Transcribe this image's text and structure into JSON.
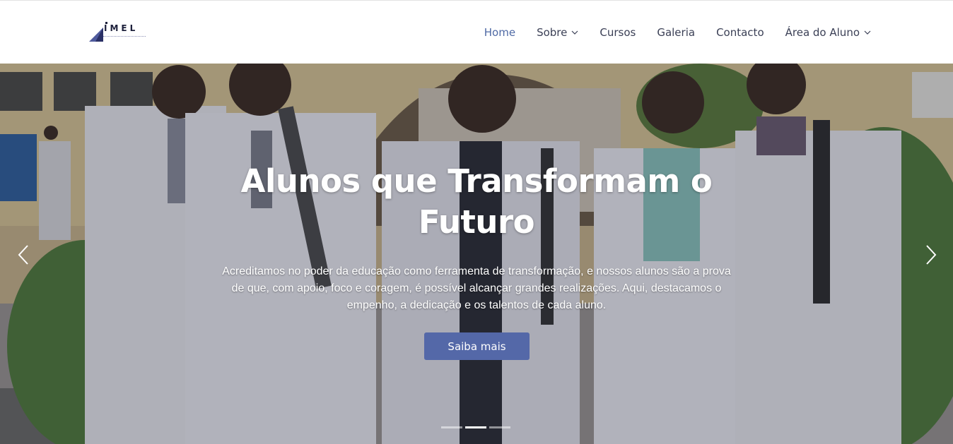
{
  "header": {
    "logo_text": "IMEL",
    "nav": [
      {
        "label": "Home",
        "active": true,
        "dropdown": false
      },
      {
        "label": "Sobre",
        "active": false,
        "dropdown": true
      },
      {
        "label": "Cursos",
        "active": false,
        "dropdown": false
      },
      {
        "label": "Galeria",
        "active": false,
        "dropdown": false
      },
      {
        "label": "Contacto",
        "active": false,
        "dropdown": false
      },
      {
        "label": "Área do Aluno",
        "active": false,
        "dropdown": true
      }
    ]
  },
  "hero": {
    "title": "Alunos que Transformam o Futuro",
    "text": "Acreditamos no poder da educação como ferramenta de transformação, e nossos alunos são a prova de que, com apoio, foco e coragem, é possível alcançar grandes realizações. Aqui, destacamos o empenho, a dedicação e os talentos de cada aluno.",
    "button_label": "Saiba mais",
    "slide_count": 3,
    "active_slide": 2
  },
  "colors": {
    "accent": "#5468a8",
    "nav_active": "#4f6aa5",
    "nav_text": "#3a3f55"
  }
}
